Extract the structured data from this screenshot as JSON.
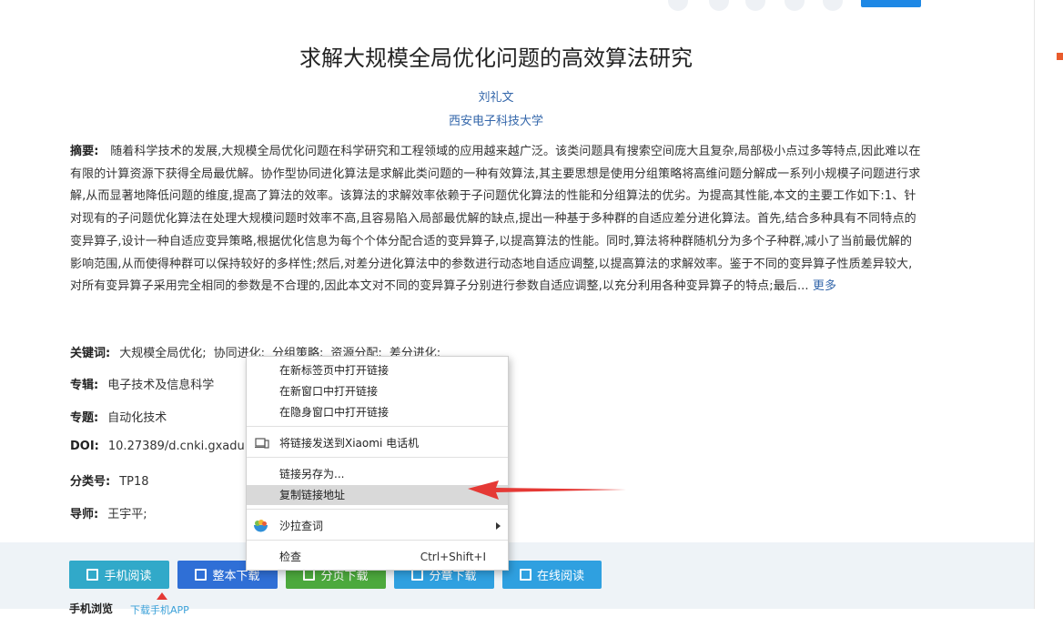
{
  "paper": {
    "title": "求解大规模全局优化问题的高效算法研究",
    "author": "刘礼文",
    "org": "西安电子科技大学",
    "abstract_label": "摘要:",
    "abstract_text": "随着科学技术的发展,大规模全局优化问题在科学研究和工程领域的应用越来越广泛。该类问题具有搜索空间庞大且复杂,局部极小点过多等特点,因此难以在有限的计算资源下获得全局最优解。协作型协同进化算法是求解此类问题的一种有效算法,其主要思想是使用分组策略将高维问题分解成一系列小规模子问题进行求解,从而显著地降低问题的维度,提高了算法的效率。该算法的求解效率依赖于子问题优化算法的性能和分组算法的优劣。为提高其性能,本文的主要工作如下:1、针对现有的子问题优化算法在处理大规模问题时效率不高,且容易陷入局部最优解的缺点,提出一种基于多种群的自适应差分进化算法。首先,结合多种具有不同特点的变异算子,设计一种自适应变异策略,根据优化信息为每个个体分配合适的变异算子,以提高算法的性能。同时,算法将种群随机分为多个子种群,减小了当前最优解的影响范围,从而使得种群可以保持较好的多样性;然后,对差分进化算法中的参数进行动态地自适应调整,以提高算法的求解效率。鉴于不同的变异算子性质差异较大,对所有变异算子采用完全相同的参数是不合理的,因此本文对不同的变异算子分别进行参数自适应调整,以充分利用各种变异算子的特点;最后...",
    "more": "更多",
    "keywords_label": "关键词:",
    "keywords": [
      "大规模全局优化;",
      "协同进化;",
      "分组策略;",
      "资源分配;",
      "差分进化;"
    ],
    "album_label": "专辑:",
    "album": "电子技术及信息科学",
    "topic_label": "专题:",
    "topic": "自动化技术",
    "doi_label": "DOI:",
    "doi": "10.27389/d.cnki.gxadu",
    "class_label": "分类号:",
    "class": "TP18",
    "advisor_label": "导师:",
    "advisor": "王宇平;"
  },
  "buttons": {
    "mobile_read": "手机阅读",
    "full_download": "整本下载",
    "page_download": "分页下载",
    "chapter_download": "分章下载",
    "online_read": "在线阅读"
  },
  "footer": {
    "phone_label": "手机浏览",
    "phone_link": "下载手机APP"
  },
  "context_menu": {
    "open_new_tab": "在新标签页中打开链接",
    "open_new_window": "在新窗口中打开链接",
    "open_incognito": "在隐身窗口中打开链接",
    "send_to_device": "将链接发送到Xiaomi 电话机",
    "save_link_as": "链接另存为...",
    "copy_link": "复制链接地址",
    "salad_lookup": "沙拉查词",
    "inspect": "检查",
    "inspect_shortcut": "Ctrl+Shift+I"
  },
  "colors": {
    "link": "#3366aa",
    "arrow": "#e53935"
  }
}
